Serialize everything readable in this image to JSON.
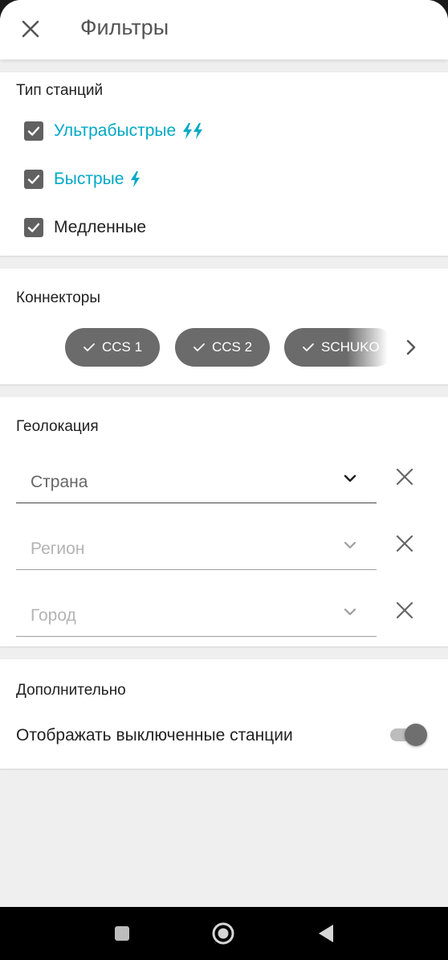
{
  "header": {
    "title": "Фильтры"
  },
  "station_types": {
    "title": "Тип станций",
    "items": [
      {
        "label": "Ультрабыстрые",
        "checked": true,
        "color": "#00a9c6",
        "icon": "double-lightning-icon"
      },
      {
        "label": "Быстрые",
        "checked": true,
        "color": "#00a9c6",
        "icon": "lightning-icon"
      },
      {
        "label": "Медленные",
        "checked": true,
        "color": "#222222"
      }
    ]
  },
  "connectors": {
    "title": "Коннекторы",
    "chips": [
      {
        "label": "CCS 1",
        "selected": true
      },
      {
        "label": "CCS 2",
        "selected": true
      },
      {
        "label": "SCHUKO",
        "selected": true
      }
    ]
  },
  "geolocation": {
    "title": "Геолокация",
    "fields": [
      {
        "placeholder": "Страна",
        "enabled": true
      },
      {
        "placeholder": "Регион",
        "enabled": false
      },
      {
        "placeholder": "Город",
        "enabled": false
      }
    ]
  },
  "additional": {
    "title": "Дополнительно",
    "toggle_label": "Отображать выключенные станции",
    "toggle_on": true
  },
  "colors": {
    "accent": "#00a9c6",
    "chip": "#6b6b6b"
  }
}
